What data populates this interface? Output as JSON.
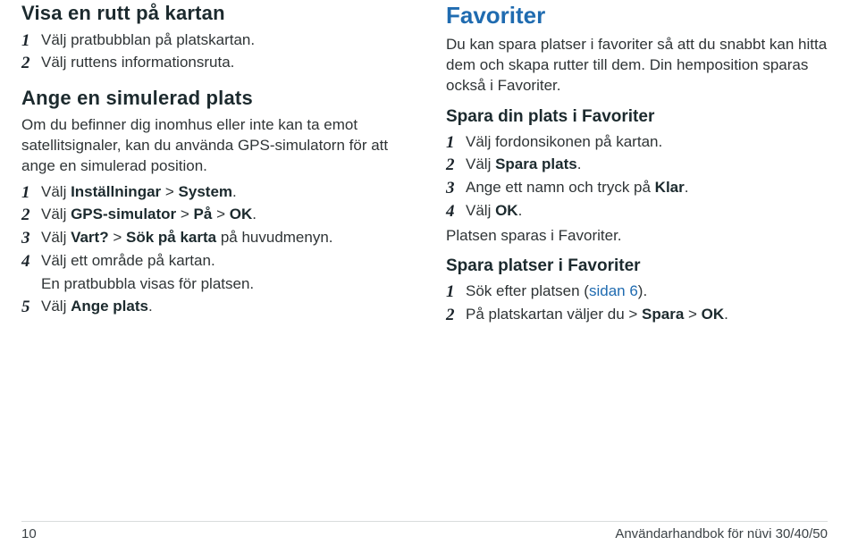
{
  "left": {
    "h1": "Visa en rutt på kartan",
    "list1": [
      "Välj pratbubblan på platskartan.",
      "Välj ruttens informationsruta."
    ],
    "h2": "Ange en simulerad plats",
    "p2": "Om du befinner dig inomhus eller inte kan ta emot satellitsignaler, kan du använda GPS-simulatorn för att ange en simulerad position.",
    "list2": [
      {
        "pre": "Välj ",
        "b": "Inställningar",
        "mid": " > ",
        "b2": "System",
        "post": "."
      },
      {
        "pre": "Välj ",
        "b": "GPS-simulator",
        "mid": " > ",
        "b2": "På",
        "mid2": " > ",
        "b3": "OK",
        "post": "."
      },
      {
        "pre": "Välj ",
        "b": "Vart?",
        "mid": " > ",
        "b2": "Sök på karta",
        "post": " på huvudmenyn."
      },
      {
        "pre": "Välj ett område på kartan."
      },
      {
        "pre": "Välj ",
        "b": "Ange plats",
        "post": "."
      }
    ],
    "note2": "En pratbubbla visas för platsen."
  },
  "right": {
    "h1": "Favoriter",
    "p1": "Du kan spara platser i favoriter så att du snabbt kan hitta dem och skapa rutter till dem. Din hemposition sparas också i Favoriter.",
    "h2": "Spara din plats i Favoriter",
    "list2": [
      {
        "pre": "Välj fordonsikonen på kartan."
      },
      {
        "pre": "Välj ",
        "b": "Spara plats",
        "post": "."
      },
      {
        "pre": "Ange ett namn och tryck på ",
        "b": "Klar",
        "post": "."
      },
      {
        "pre": "Välj ",
        "b": "OK",
        "post": "."
      }
    ],
    "note2": "Platsen sparas i Favoriter.",
    "h3": "Spara platser i Favoriter",
    "list3": [
      {
        "pre": "Sök efter platsen (",
        "link": "sidan 6",
        "post": ")."
      },
      {
        "pre": "På platskartan väljer du > ",
        "b": "Spara",
        "mid": " > ",
        "b2": "OK",
        "post": "."
      }
    ]
  },
  "footer": {
    "page": "10",
    "title": "Användarhandbok för nüvi 30/40/50"
  }
}
